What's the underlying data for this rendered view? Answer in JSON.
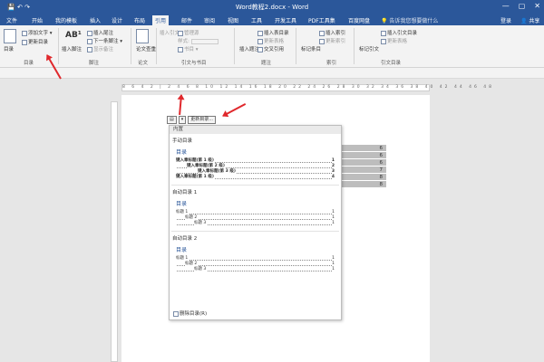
{
  "window": {
    "title": "Word教程2.docx - Word",
    "controls": [
      "—",
      "▢",
      "✕"
    ]
  },
  "quick_access": [
    "💾",
    "↶",
    "↷"
  ],
  "tabs": [
    "文件",
    "开始",
    "我的模板",
    "插入",
    "设计",
    "布局",
    "引用",
    "邮件",
    "审阅",
    "视图",
    "工具",
    "开发工具",
    "PDF工具集",
    "百度网盘"
  ],
  "active_tab": "引用",
  "tell_me": "告诉我您想要做什么",
  "account": {
    "login": "登录",
    "share": "共享"
  },
  "ribbon": {
    "toc_group": {
      "label": "目录",
      "big_button": "目录",
      "add_text": "添加文字 ▾",
      "update_toc": "更新目录"
    },
    "footnote_group": {
      "label": "脚注",
      "insert_footnote": "插入脚注",
      "ab": "AB¹",
      "insert_endnote": "插入尾注",
      "next_footnote": "下一条脚注 ▾",
      "show_notes": "显示备注"
    },
    "research_group": {
      "label": "信息检索",
      "smart_lookup": "智能查找"
    },
    "paper_group": {
      "label": "论文",
      "paper_check": "论文查重"
    },
    "citation_group": {
      "label": "引文与书目",
      "insert_citation": "插入引文",
      "manage_sources": "管理源",
      "style": "样式:",
      "bibliography": "书目 ▾"
    },
    "caption_group": {
      "label": "题注",
      "insert_caption": "插入题注",
      "insert_table_figures": "插入表目录",
      "update_table": "更新表格",
      "cross_reference": "交叉引用"
    },
    "index_group": {
      "label": "索引",
      "mark_entry": "标记条目",
      "insert_index": "插入索引",
      "update_index": "更新索引"
    },
    "authorities_group": {
      "label": "引文目录",
      "mark_citation": "标记引文",
      "insert_authorities": "插入引文目录",
      "update_authorities": "更新表格"
    }
  },
  "ruler_numbers": "8 6 4 2 | 2 4 6 8 10 12 14 16 18 20 22 24 26 28 30 32 34 36 38 40 42 44 46 48",
  "toc_control": {
    "icon": "▤",
    "dropdown": "▾",
    "update_button": "更新目录..."
  },
  "greyed_page_numbers": [
    "6",
    "6",
    "6",
    "7",
    "8",
    "8"
  ],
  "gallery": {
    "header": "内置",
    "manual": {
      "title": "手动目录",
      "heading": "目录",
      "lines": [
        {
          "text": "键入章标题(第 1 级)",
          "page": "1",
          "indent": 0
        },
        {
          "text": "键入章标题(第 2 级)",
          "page": "2",
          "indent": 1
        },
        {
          "text": "键入章标题(第 3 级)",
          "page": "3",
          "indent": 2
        },
        {
          "text": "键入章标题(第 1 级)",
          "page": "4",
          "indent": 0
        }
      ]
    },
    "auto1": {
      "title": "自动目录 1",
      "heading": "目录",
      "lines": [
        {
          "text": "标题 1",
          "page": "1",
          "indent": 0
        },
        {
          "text": "标题 2",
          "page": "1",
          "indent": 1
        },
        {
          "text": "标题 3",
          "page": "1",
          "indent": 2
        }
      ]
    },
    "auto2": {
      "title": "自动目录 2",
      "heading": "目录",
      "lines": [
        {
          "text": "标题 1",
          "page": "1",
          "indent": 0
        },
        {
          "text": "标题 2",
          "page": "1",
          "indent": 1
        },
        {
          "text": "标题 3",
          "page": "1",
          "indent": 2
        }
      ]
    },
    "remove": "删除目录(R)"
  },
  "colors": {
    "accent": "#2b579a",
    "annotation_arrow": "#e0282c"
  }
}
